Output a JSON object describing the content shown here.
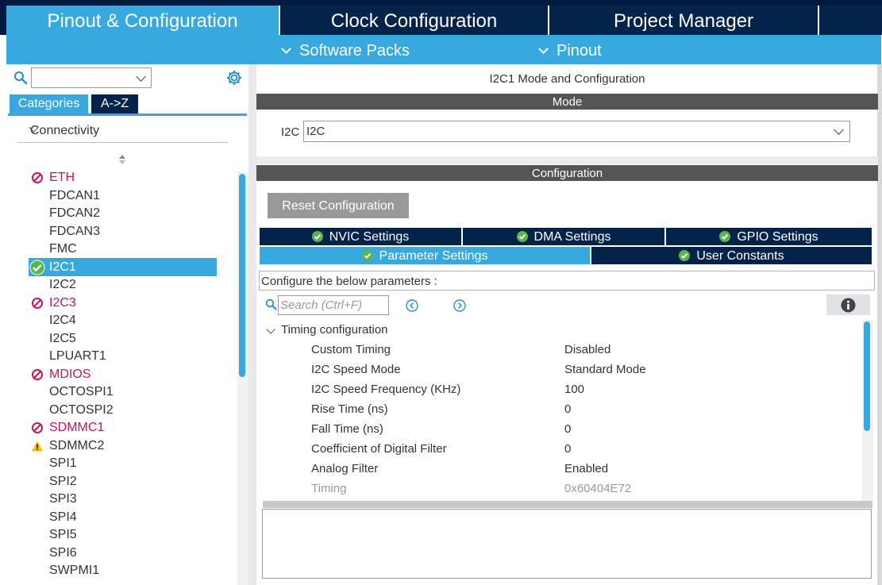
{
  "top_tabs": [
    {
      "label": "Pinout & Configuration"
    },
    {
      "label": "Clock Configuration"
    },
    {
      "label": "Project Manager"
    },
    {
      "label": ""
    }
  ],
  "sub_menu": {
    "software_packs": "Software Packs",
    "pinout": "Pinout"
  },
  "sidebar": {
    "search_value": "",
    "tabs": {
      "categories": "Categories",
      "atoz": "A->Z"
    },
    "category": "Connectivity",
    "items": [
      {
        "label": "ETH",
        "status": "disabled"
      },
      {
        "label": "FDCAN1",
        "status": "none"
      },
      {
        "label": "FDCAN2",
        "status": "none"
      },
      {
        "label": "FDCAN3",
        "status": "none"
      },
      {
        "label": "FMC",
        "status": "none"
      },
      {
        "label": "I2C1",
        "status": "ok",
        "selected": true
      },
      {
        "label": "I2C2",
        "status": "none"
      },
      {
        "label": "I2C3",
        "status": "disabled"
      },
      {
        "label": "I2C4",
        "status": "none"
      },
      {
        "label": "I2C5",
        "status": "none"
      },
      {
        "label": "LPUART1",
        "status": "none"
      },
      {
        "label": "MDIOS",
        "status": "disabled"
      },
      {
        "label": "OCTOSPI1",
        "status": "none"
      },
      {
        "label": "OCTOSPI2",
        "status": "none"
      },
      {
        "label": "SDMMC1",
        "status": "disabled"
      },
      {
        "label": "SDMMC2",
        "status": "warning"
      },
      {
        "label": "SPI1",
        "status": "none"
      },
      {
        "label": "SPI2",
        "status": "none"
      },
      {
        "label": "SPI3",
        "status": "none"
      },
      {
        "label": "SPI4",
        "status": "none"
      },
      {
        "label": "SPI5",
        "status": "none"
      },
      {
        "label": "SPI6",
        "status": "none"
      },
      {
        "label": "SWPMI1",
        "status": "none"
      }
    ]
  },
  "main": {
    "title": "I2C1 Mode and Configuration",
    "mode_header": "Mode",
    "mode_label": "I2C",
    "mode_value": "I2C",
    "config_header": "Configuration",
    "reset_button": "Reset Configuration",
    "tabs": [
      {
        "label": "NVIC Settings"
      },
      {
        "label": "DMA Settings"
      },
      {
        "label": "GPIO Settings"
      },
      {
        "label": "Parameter Settings",
        "active": true
      },
      {
        "label": "User Constants"
      }
    ],
    "param_hint": "Configure the below parameters :",
    "search_placeholder": "Search (Ctrl+F)",
    "group": "Timing configuration",
    "params": [
      {
        "name": "Custom Timing",
        "value": "Disabled"
      },
      {
        "name": "I2C Speed Mode",
        "value": "Standard Mode"
      },
      {
        "name": "I2C Speed Frequency (KHz)",
        "value": "100"
      },
      {
        "name": "Rise Time (ns)",
        "value": "0"
      },
      {
        "name": "Fall Time (ns)",
        "value": "0"
      },
      {
        "name": "Coefficient of Digital Filter",
        "value": "0"
      },
      {
        "name": "Analog Filter",
        "value": "Enabled"
      },
      {
        "name": "Timing",
        "value": "0x60404E72",
        "disabled": true
      }
    ]
  },
  "colors": {
    "accent": "#38a9de",
    "navy": "#03234b",
    "disabled_red": "#c2185b",
    "ok_green": "#5bb54a",
    "warn_yellow": "#f2c200"
  }
}
